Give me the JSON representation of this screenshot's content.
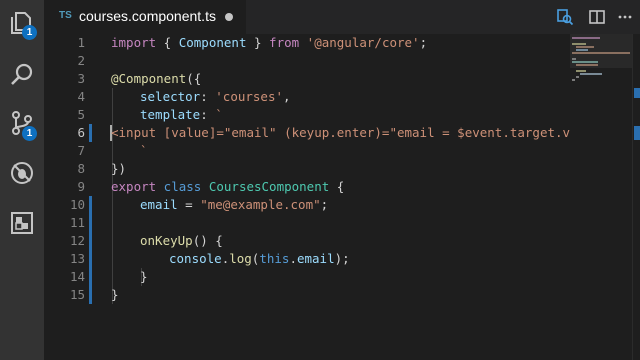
{
  "activity_bar": {
    "explorer_badge": "1",
    "scm_badge": "1"
  },
  "tab": {
    "lang_badge": "TS",
    "title": "courses.component.ts"
  },
  "code": {
    "lines": [
      {
        "n": "1"
      },
      {
        "n": "2"
      },
      {
        "n": "3"
      },
      {
        "n": "4"
      },
      {
        "n": "5"
      },
      {
        "n": "6"
      },
      {
        "n": "7"
      },
      {
        "n": "8"
      },
      {
        "n": "9"
      },
      {
        "n": "10"
      },
      {
        "n": "11"
      },
      {
        "n": "12"
      },
      {
        "n": "13"
      },
      {
        "n": "14"
      },
      {
        "n": "15"
      }
    ],
    "tokens": {
      "l1_import": "import",
      "l1_open": " { ",
      "l1_component": "Component",
      "l1_close": " } ",
      "l1_from": "from",
      "l1_str": " '@angular/core'",
      "l1_semi": ";",
      "l3_dec": "@Component",
      "l3_punc": "({",
      "l4_key": "selector",
      "l4_colon": ": ",
      "l4_val": "'courses'",
      "l4_comma": ",",
      "l5_key": "template",
      "l5_colon": ": ",
      "l5_val": "`",
      "l6_val": "<input [value]=\"email\" (keyup.enter)=\"email = $event.target.valu",
      "l7_val": "`",
      "l8_punc": "})",
      "l9_export": "export",
      "l9_class": " class ",
      "l9_name": "CoursesComponent",
      "l9_brace": " {",
      "l10_prop": "email",
      "l10_eq": " = ",
      "l10_val": "\"me@example.com\"",
      "l10_semi": ";",
      "l12_fn": "onKeyUp",
      "l12_punc": "() {",
      "l13_obj": "console",
      "l13_dot": ".",
      "l13_fn": "log",
      "l13_open": "(",
      "l13_this": "this",
      "l13_dot2": ".",
      "l13_prop": "email",
      "l13_close": ");",
      "l14_punc": "}",
      "l15_punc": "}"
    }
  },
  "colors": {
    "background": "#1e1e1e",
    "activity_bar": "#333333",
    "badge": "#0e70c0",
    "keyword": "#c586c0",
    "string": "#ce9178",
    "class": "#4ec9b0",
    "property": "#9cdcfe"
  }
}
